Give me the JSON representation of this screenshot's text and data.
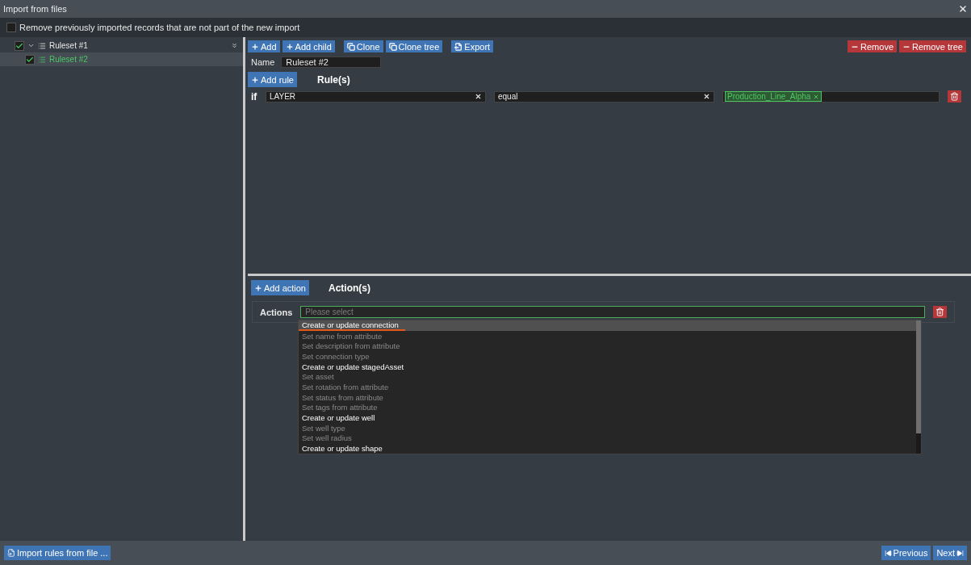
{
  "window": {
    "title": "Import from files"
  },
  "remove_previous": {
    "label": "Remove previously imported records that are not part of the new import",
    "checked": false
  },
  "tree": {
    "items": [
      {
        "label": "Ruleset #1",
        "checked": true,
        "expanded": true,
        "selected": false,
        "children": [
          {
            "label": "Ruleset #2",
            "checked": true,
            "selected": true
          }
        ]
      }
    ]
  },
  "toolbar": {
    "left": [
      {
        "label": "Add",
        "kind": "plus"
      },
      {
        "label": "Add child",
        "kind": "plus"
      },
      {
        "label": "Clone",
        "kind": "copy"
      },
      {
        "label": "Clone tree",
        "kind": "copy"
      },
      {
        "label": "Export",
        "kind": "export"
      }
    ],
    "right": [
      {
        "label": "Remove",
        "kind": "minus"
      },
      {
        "label": "Remove tree",
        "kind": "minus"
      }
    ]
  },
  "name_field": {
    "label": "Name",
    "value": "Ruleset #2"
  },
  "rules": {
    "add_label": "Add rule",
    "heading": "Rule(s)",
    "rows": [
      {
        "keyword": "if",
        "attribute": "LAYER",
        "operator": "equal",
        "values": [
          "Production_Line_Alpha"
        ]
      }
    ]
  },
  "actions": {
    "add_label": "Add action",
    "heading": "Action(s)",
    "label": "Actions",
    "placeholder": "Please select",
    "options": [
      {
        "label": "Create or update connection",
        "kind": "group",
        "selected": true
      },
      {
        "label": "Set name from attribute",
        "kind": "option",
        "selected": false
      },
      {
        "label": "Set description from attribute",
        "kind": "option",
        "selected": false
      },
      {
        "label": "Set connection type",
        "kind": "option",
        "selected": false
      },
      {
        "label": "Create or update stagedAsset",
        "kind": "group",
        "selected": false
      },
      {
        "label": "Set asset",
        "kind": "option",
        "selected": false
      },
      {
        "label": "Set rotation from attribute",
        "kind": "option",
        "selected": false
      },
      {
        "label": "Set status from attribute",
        "kind": "option",
        "selected": false
      },
      {
        "label": "Set tags from attribute",
        "kind": "option",
        "selected": false
      },
      {
        "label": "Create or update well",
        "kind": "group",
        "selected": false
      },
      {
        "label": "Set well type",
        "kind": "option",
        "selected": false
      },
      {
        "label": "Set well radius",
        "kind": "option",
        "selected": false
      },
      {
        "label": "Create or update shape",
        "kind": "group",
        "selected": false
      }
    ]
  },
  "footer": {
    "import": "Import rules from file ...",
    "previous": "Previous",
    "next": "Next"
  }
}
